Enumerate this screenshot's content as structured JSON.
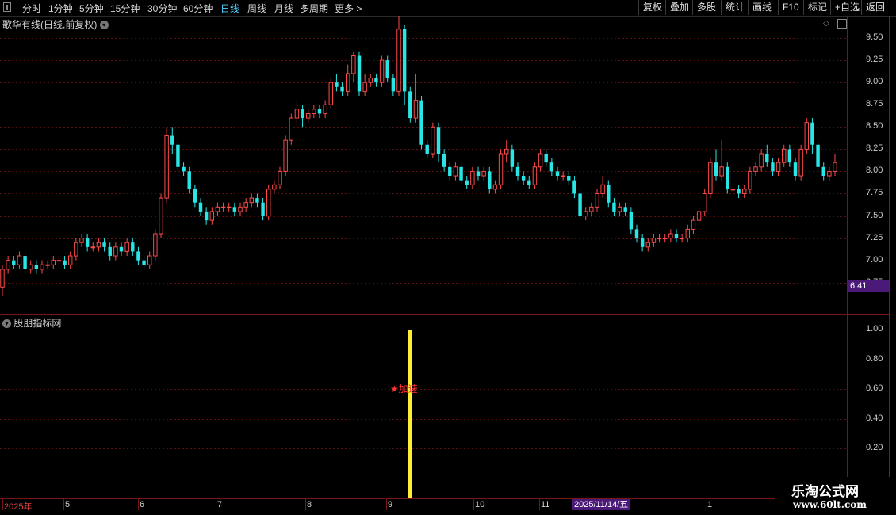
{
  "toolbar": {
    "periods": [
      {
        "label": "分时",
        "active": false
      },
      {
        "label": "1分钟",
        "active": false
      },
      {
        "label": "5分钟",
        "active": false
      },
      {
        "label": "15分钟",
        "active": false
      },
      {
        "label": "30分钟",
        "active": false
      },
      {
        "label": "60分钟",
        "active": false
      },
      {
        "label": "日线",
        "active": true
      },
      {
        "label": "周线",
        "active": false
      },
      {
        "label": "月线",
        "active": false
      },
      {
        "label": "多周期",
        "active": false
      },
      {
        "label": "更多 >",
        "active": false
      }
    ],
    "buttons": [
      "复权",
      "叠加",
      "多股",
      "统计",
      "画线",
      "F10",
      "标记",
      "+自选",
      "返回"
    ]
  },
  "main_chart": {
    "title": "歌华有线(日线,前复权)",
    "y_ticks": [
      "9.50",
      "9.25",
      "9.00",
      "8.75",
      "8.50",
      "8.25",
      "8.00",
      "7.75",
      "7.50",
      "7.25",
      "7.00",
      "6.75"
    ],
    "price_tag": "6.41"
  },
  "indicator": {
    "title": "股朋指标网",
    "y_ticks": [
      "1.00",
      "0.80",
      "0.60",
      "0.40",
      "0.20"
    ],
    "signal_label": "★加速"
  },
  "date_axis": {
    "labels": [
      "2025年",
      "5",
      "6",
      "7",
      "8",
      "9",
      "10",
      "11",
      "1"
    ],
    "cursor_date": "2025/11/14/五"
  },
  "watermark": {
    "title": "乐淘公式网",
    "url": "www.60lt.com"
  },
  "chart_data": {
    "type": "candlestick",
    "ylim": [
      6.4,
      9.75
    ],
    "y_ticks": [
      9.5,
      9.25,
      9.0,
      8.75,
      8.5,
      8.25,
      8.0,
      7.75,
      7.5,
      7.25,
      7.0,
      6.75
    ],
    "candles": [
      [
        6.7,
        6.9,
        6.6,
        6.95
      ],
      [
        6.9,
        7.0,
        6.85,
        7.05
      ],
      [
        7.0,
        6.95,
        6.9,
        7.05
      ],
      [
        6.95,
        7.05,
        6.9,
        7.1
      ],
      [
        7.05,
        6.9,
        6.85,
        7.1
      ],
      [
        6.9,
        6.95,
        6.85,
        7.0
      ],
      [
        6.95,
        6.9,
        6.85,
        7.0
      ],
      [
        6.9,
        6.95,
        6.85,
        7.0
      ],
      [
        6.95,
        6.95,
        6.9,
        7.0
      ],
      [
        6.95,
        7.0,
        6.9,
        7.05
      ],
      [
        7.0,
        7.0,
        6.95,
        7.05
      ],
      [
        7.0,
        6.95,
        6.9,
        7.05
      ],
      [
        6.95,
        7.05,
        6.9,
        7.1
      ],
      [
        7.05,
        7.2,
        7.0,
        7.25
      ],
      [
        7.2,
        7.25,
        7.15,
        7.3
      ],
      [
        7.25,
        7.15,
        7.1,
        7.3
      ],
      [
        7.15,
        7.15,
        7.1,
        7.2
      ],
      [
        7.15,
        7.2,
        7.1,
        7.25
      ],
      [
        7.2,
        7.15,
        7.1,
        7.25
      ],
      [
        7.15,
        7.05,
        7.0,
        7.2
      ],
      [
        7.05,
        7.15,
        7.0,
        7.2
      ],
      [
        7.15,
        7.1,
        7.05,
        7.2
      ],
      [
        7.1,
        7.2,
        7.05,
        7.25
      ],
      [
        7.2,
        7.1,
        7.05,
        7.25
      ],
      [
        7.1,
        7.0,
        6.95,
        7.15
      ],
      [
        7.0,
        6.95,
        6.9,
        7.05
      ],
      [
        6.95,
        7.05,
        6.9,
        7.1
      ],
      [
        7.05,
        7.3,
        7.0,
        7.35
      ],
      [
        7.3,
        7.7,
        7.25,
        7.75
      ],
      [
        7.7,
        8.4,
        7.65,
        8.5
      ],
      [
        8.4,
        8.3,
        8.2,
        8.5
      ],
      [
        8.3,
        8.05,
        8.0,
        8.35
      ],
      [
        8.05,
        8.0,
        7.95,
        8.1
      ],
      [
        8.0,
        7.8,
        7.75,
        8.05
      ],
      [
        7.8,
        7.65,
        7.6,
        7.85
      ],
      [
        7.65,
        7.55,
        7.5,
        7.7
      ],
      [
        7.55,
        7.45,
        7.4,
        7.6
      ],
      [
        7.45,
        7.55,
        7.4,
        7.6
      ],
      [
        7.55,
        7.6,
        7.5,
        7.65
      ],
      [
        7.6,
        7.6,
        7.55,
        7.65
      ],
      [
        7.6,
        7.6,
        7.55,
        7.65
      ],
      [
        7.6,
        7.55,
        7.5,
        7.65
      ],
      [
        7.55,
        7.6,
        7.5,
        7.65
      ],
      [
        7.6,
        7.65,
        7.55,
        7.7
      ],
      [
        7.65,
        7.7,
        7.6,
        7.75
      ],
      [
        7.7,
        7.65,
        7.6,
        7.75
      ],
      [
        7.65,
        7.5,
        7.45,
        7.7
      ],
      [
        7.5,
        7.8,
        7.45,
        7.85
      ],
      [
        7.8,
        7.85,
        7.75,
        7.9
      ],
      [
        7.85,
        8.0,
        7.8,
        8.05
      ],
      [
        8.0,
        8.35,
        7.95,
        8.4
      ],
      [
        8.35,
        8.6,
        8.3,
        8.65
      ],
      [
        8.6,
        8.7,
        8.5,
        8.8
      ],
      [
        8.7,
        8.6,
        8.5,
        8.75
      ],
      [
        8.6,
        8.65,
        8.55,
        8.7
      ],
      [
        8.65,
        8.7,
        8.6,
        8.75
      ],
      [
        8.7,
        8.65,
        8.6,
        8.75
      ],
      [
        8.65,
        8.75,
        8.6,
        8.8
      ],
      [
        8.75,
        9.0,
        8.7,
        9.05
      ],
      [
        9.0,
        8.95,
        8.9,
        9.1
      ],
      [
        8.95,
        8.9,
        8.85,
        9.0
      ],
      [
        8.9,
        9.1,
        8.85,
        9.2
      ],
      [
        9.1,
        9.3,
        9.0,
        9.35
      ],
      [
        9.3,
        8.9,
        8.85,
        9.35
      ],
      [
        8.9,
        9.0,
        8.85,
        9.1
      ],
      [
        9.0,
        9.05,
        8.95,
        9.1
      ],
      [
        9.05,
        9.0,
        8.95,
        9.1
      ],
      [
        9.0,
        9.25,
        8.95,
        9.3
      ],
      [
        9.25,
        9.05,
        9.0,
        9.3
      ],
      [
        9.05,
        8.9,
        8.85,
        9.1
      ],
      [
        8.9,
        9.6,
        8.85,
        9.75
      ],
      [
        9.6,
        8.9,
        8.75,
        9.65
      ],
      [
        8.9,
        8.6,
        8.55,
        8.95
      ],
      [
        8.6,
        8.8,
        8.55,
        9.1
      ],
      [
        8.8,
        8.3,
        8.25,
        8.85
      ],
      [
        8.3,
        8.2,
        8.15,
        8.35
      ],
      [
        8.2,
        8.5,
        8.15,
        8.55
      ],
      [
        8.5,
        8.2,
        8.1,
        8.55
      ],
      [
        8.2,
        8.05,
        8.0,
        8.25
      ],
      [
        8.05,
        7.95,
        7.9,
        8.1
      ],
      [
        7.95,
        8.05,
        7.9,
        8.1
      ],
      [
        8.05,
        7.9,
        7.85,
        8.1
      ],
      [
        7.9,
        7.85,
        7.8,
        7.95
      ],
      [
        7.85,
        8.0,
        7.8,
        8.05
      ],
      [
        8.0,
        7.95,
        7.9,
        8.05
      ],
      [
        7.95,
        8.0,
        7.9,
        8.05
      ],
      [
        8.0,
        7.8,
        7.75,
        8.05
      ],
      [
        7.8,
        7.85,
        7.75,
        7.9
      ],
      [
        7.85,
        8.2,
        7.8,
        8.25
      ],
      [
        8.2,
        8.25,
        8.1,
        8.35
      ],
      [
        8.25,
        8.05,
        8.0,
        8.3
      ],
      [
        8.05,
        7.95,
        7.9,
        8.1
      ],
      [
        7.95,
        7.9,
        7.85,
        8.0
      ],
      [
        7.9,
        7.85,
        7.8,
        7.95
      ],
      [
        7.85,
        8.05,
        7.8,
        8.1
      ],
      [
        8.05,
        8.2,
        8.0,
        8.25
      ],
      [
        8.2,
        8.1,
        8.05,
        8.25
      ],
      [
        8.1,
        8.0,
        7.95,
        8.15
      ],
      [
        8.0,
        7.95,
        7.9,
        8.05
      ],
      [
        7.95,
        7.95,
        7.9,
        8.0
      ],
      [
        7.95,
        7.9,
        7.85,
        8.0
      ],
      [
        7.9,
        7.75,
        7.7,
        7.95
      ],
      [
        7.75,
        7.5,
        7.45,
        7.8
      ],
      [
        7.5,
        7.55,
        7.45,
        7.6
      ],
      [
        7.55,
        7.6,
        7.5,
        7.65
      ],
      [
        7.6,
        7.75,
        7.55,
        7.8
      ],
      [
        7.75,
        7.85,
        7.7,
        7.95
      ],
      [
        7.85,
        7.65,
        7.6,
        7.9
      ],
      [
        7.65,
        7.55,
        7.5,
        7.7
      ],
      [
        7.55,
        7.6,
        7.5,
        7.65
      ],
      [
        7.6,
        7.55,
        7.5,
        7.65
      ],
      [
        7.55,
        7.35,
        7.3,
        7.6
      ],
      [
        7.35,
        7.25,
        7.2,
        7.4
      ],
      [
        7.25,
        7.15,
        7.1,
        7.3
      ],
      [
        7.15,
        7.2,
        7.1,
        7.25
      ],
      [
        7.2,
        7.25,
        7.15,
        7.3
      ],
      [
        7.25,
        7.25,
        7.2,
        7.3
      ],
      [
        7.25,
        7.25,
        7.2,
        7.3
      ],
      [
        7.25,
        7.3,
        7.2,
        7.35
      ],
      [
        7.3,
        7.25,
        7.2,
        7.35
      ],
      [
        7.25,
        7.25,
        7.2,
        7.3
      ],
      [
        7.25,
        7.35,
        7.2,
        7.4
      ],
      [
        7.35,
        7.45,
        7.3,
        7.5
      ],
      [
        7.45,
        7.55,
        7.4,
        7.6
      ],
      [
        7.55,
        7.75,
        7.5,
        7.8
      ],
      [
        7.75,
        8.1,
        7.7,
        8.15
      ],
      [
        8.1,
        7.95,
        7.9,
        8.25
      ],
      [
        7.95,
        8.05,
        7.9,
        8.35
      ],
      [
        8.05,
        7.8,
        7.75,
        8.1
      ],
      [
        7.8,
        7.8,
        7.75,
        7.85
      ],
      [
        7.8,
        7.75,
        7.7,
        7.85
      ],
      [
        7.75,
        7.8,
        7.7,
        7.85
      ],
      [
        7.8,
        8.0,
        7.75,
        8.05
      ],
      [
        8.0,
        8.05,
        7.95,
        8.1
      ],
      [
        8.05,
        8.2,
        8.0,
        8.25
      ],
      [
        8.2,
        8.1,
        8.05,
        8.3
      ],
      [
        8.1,
        8.0,
        7.95,
        8.15
      ],
      [
        8.0,
        8.1,
        7.95,
        8.15
      ],
      [
        8.1,
        8.25,
        8.05,
        8.3
      ],
      [
        8.25,
        8.1,
        8.05,
        8.3
      ],
      [
        8.1,
        7.95,
        7.9,
        8.15
      ],
      [
        7.95,
        8.25,
        7.9,
        8.3
      ],
      [
        8.25,
        8.55,
        8.2,
        8.6
      ],
      [
        8.55,
        8.3,
        8.2,
        8.6
      ],
      [
        8.3,
        8.05,
        8.0,
        8.35
      ],
      [
        8.05,
        7.95,
        7.9,
        8.1
      ],
      [
        7.95,
        8.0,
        7.9,
        8.05
      ],
      [
        8.0,
        8.1,
        7.95,
        8.2
      ]
    ],
    "indicator_signal": {
      "candle_index": 70,
      "value": 1.0
    }
  }
}
